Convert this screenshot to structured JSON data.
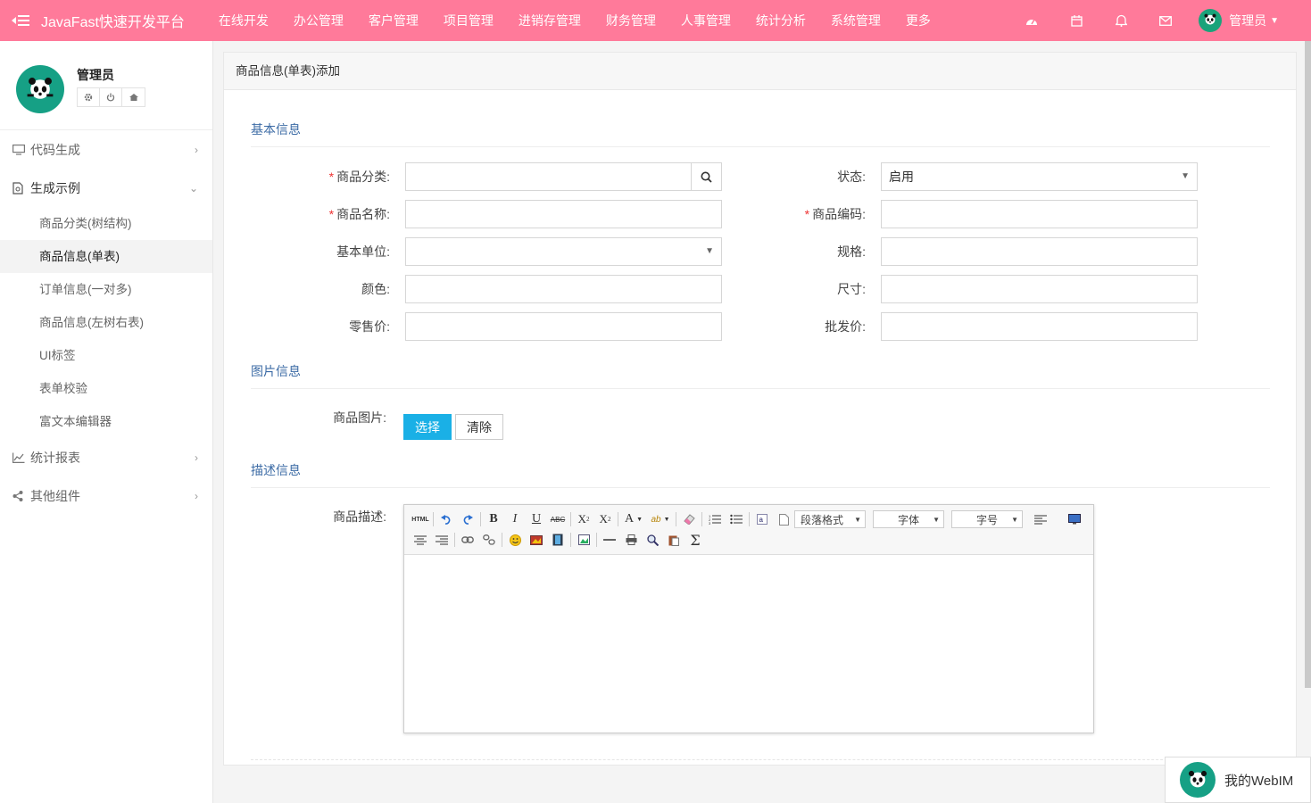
{
  "app": {
    "brand": "JavaFast快速开发平台",
    "top_nav": [
      "在线开发",
      "办公管理",
      "客户管理",
      "项目管理",
      "进销存管理",
      "财务管理",
      "人事管理",
      "统计分析",
      "系统管理",
      "更多"
    ],
    "user_label": "管理员"
  },
  "sidebar": {
    "user_name": "管理员",
    "groups": [
      {
        "label": "代码生成",
        "icon": "monitor-icon",
        "expanded": false
      },
      {
        "label": "生成示例",
        "icon": "document-icon",
        "expanded": true,
        "items": [
          "商品分类(树结构)",
          "商品信息(单表)",
          "订单信息(一对多)",
          "商品信息(左树右表)",
          "UI标签",
          "表单校验",
          "富文本编辑器"
        ],
        "active_index": 1
      },
      {
        "label": "统计报表",
        "icon": "chart-icon",
        "expanded": false
      },
      {
        "label": "其他组件",
        "icon": "share-icon",
        "expanded": false
      }
    ]
  },
  "page": {
    "title": "商品信息(单表)添加",
    "sections": {
      "basic": "基本信息",
      "image": "图片信息",
      "desc": "描述信息"
    },
    "fields": {
      "category": {
        "label": "商品分类:",
        "value": "",
        "required": true
      },
      "status": {
        "label": "状态:",
        "value": "启用"
      },
      "name": {
        "label": "商品名称:",
        "value": "",
        "required": true
      },
      "code": {
        "label": "商品编码:",
        "value": "",
        "required": true
      },
      "unit": {
        "label": "基本单位:",
        "value": ""
      },
      "spec": {
        "label": "规格:",
        "value": ""
      },
      "color": {
        "label": "颜色:",
        "value": ""
      },
      "size": {
        "label": "尺寸:",
        "value": ""
      },
      "retail": {
        "label": "零售价:",
        "value": ""
      },
      "wholesale": {
        "label": "批发价:",
        "value": ""
      },
      "image": {
        "label": "商品图片:"
      },
      "description": {
        "label": "商品描述:"
      }
    },
    "buttons": {
      "choose": "选择",
      "clear": "清除"
    },
    "editor": {
      "html_label": "HTML",
      "paragraph": "段落格式",
      "font": "字体",
      "font_size": "字号"
    }
  },
  "webim": {
    "label": "我的WebIM"
  },
  "colors": {
    "topbar": "#ff7a9a",
    "primary": "#1ab0e6",
    "section": "#3c6ba5"
  }
}
